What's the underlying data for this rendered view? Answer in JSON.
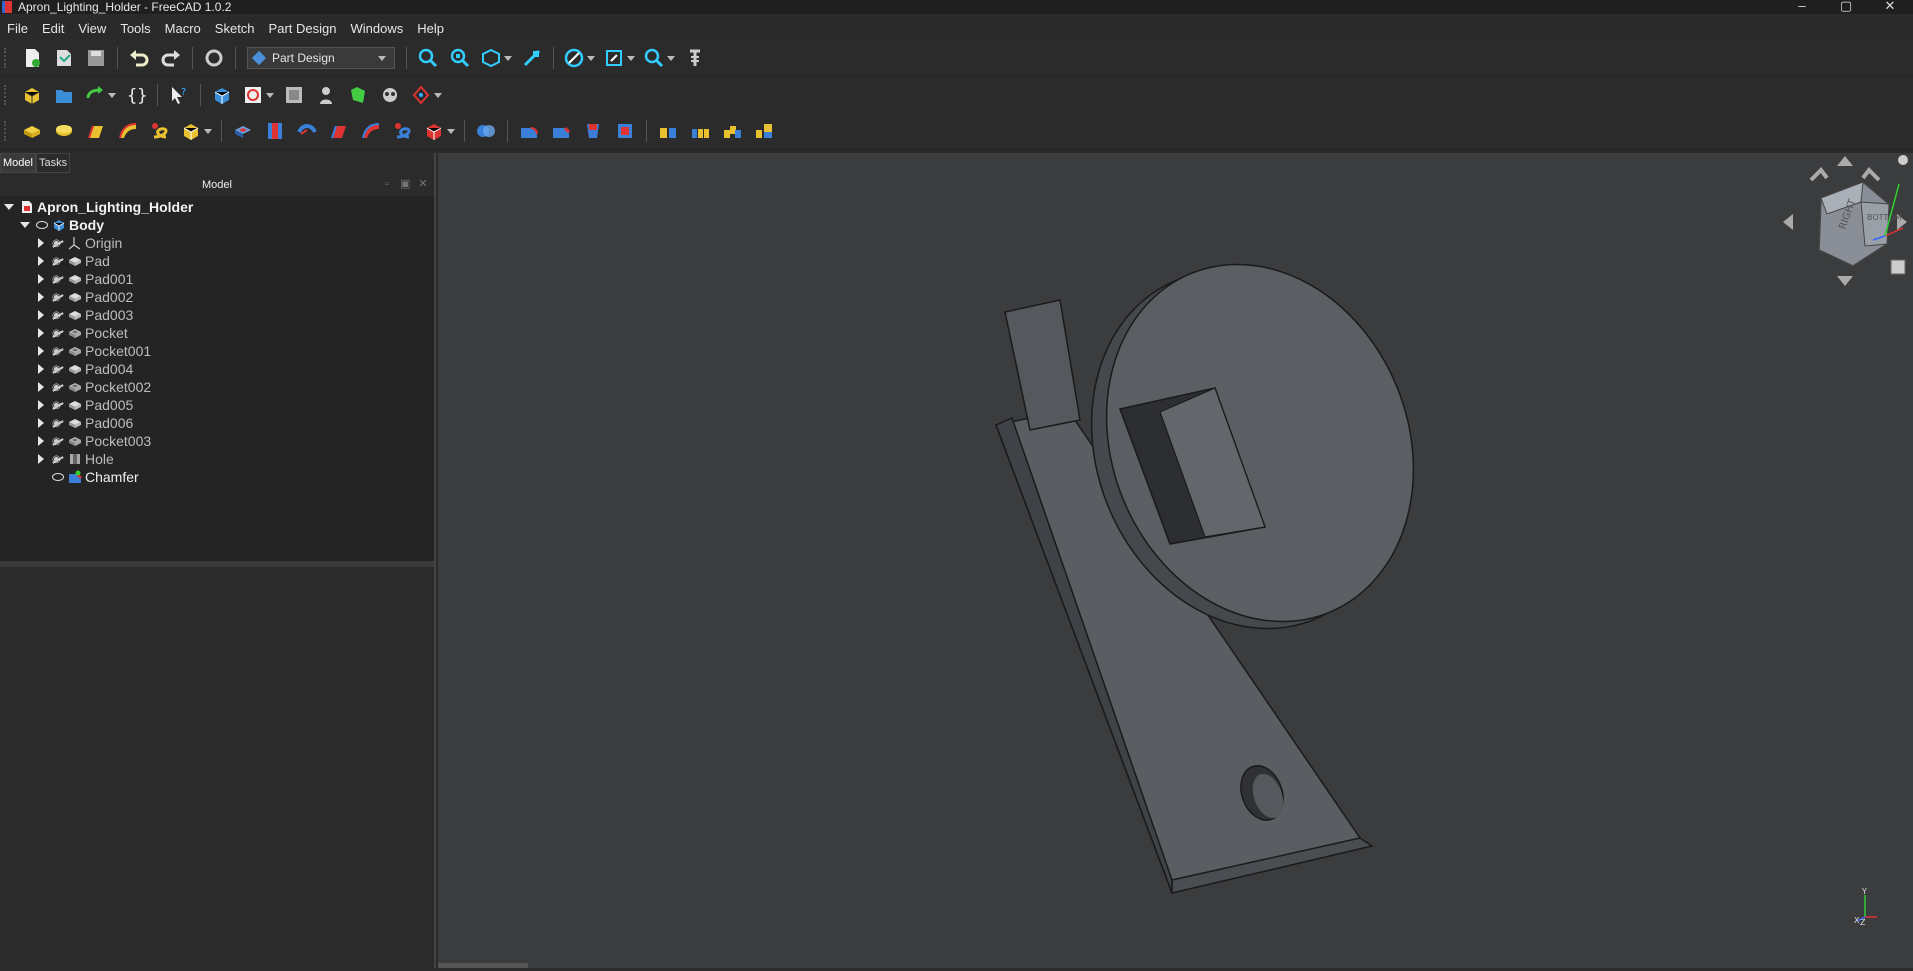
{
  "window": {
    "title": "Apron_Lighting_Holder - FreeCAD 1.0.2",
    "controls": [
      "–",
      "▢",
      "✕"
    ]
  },
  "menu": [
    "File",
    "Edit",
    "View",
    "Tools",
    "Macro",
    "Sketch",
    "Part Design",
    "Windows",
    "Help"
  ],
  "toolbar": {
    "workbench": "Part Design",
    "row1_icons": [
      "new-document-icon",
      "open-document-icon",
      "save-icon",
      "undo-icon",
      "redo-icon",
      "refresh-icon",
      "fit-all-icon",
      "fit-selection-icon",
      "isometric-view-icon",
      "measure-icon",
      "draw-style-icon",
      "std-views-icon",
      "zoom-icon",
      "measure-tool-icon"
    ],
    "row2_icons": [
      "create-part-icon",
      "create-group-icon",
      "link-icon",
      "braces-icon",
      "whats-this-icon",
      "create-body-icon",
      "create-sketch-icon",
      "attach-sketch-icon",
      "validate-sketch-icon",
      "clone-icon",
      "shape-binder-icon",
      "datum-icon"
    ],
    "row3_icons": [
      "pad-icon",
      "revolution-icon",
      "loft-icon",
      "pipe-icon",
      "helix-icon",
      "additive-primitive-icon",
      "pocket-icon",
      "hole-icon",
      "groove-icon",
      "subtractive-loft-icon",
      "subtractive-pipe-icon",
      "subtractive-helix-icon",
      "subtractive-primitive-icon",
      "boolean-icon",
      "fillet-icon",
      "chamfer-icon",
      "draft-icon",
      "thickness-icon",
      "mirrored-icon",
      "linear-pattern-icon",
      "polar-pattern-icon",
      "multi-transform-icon"
    ]
  },
  "panel": {
    "tabs": [
      "Model",
      "Tasks"
    ],
    "header": "Model",
    "tree": [
      {
        "label": "Apron_Lighting_Holder",
        "level": 0,
        "expanded": true,
        "icon": "document-icon",
        "bold": true
      },
      {
        "label": "Body",
        "level": 1,
        "expanded": true,
        "icon": "body-icon",
        "bold": true,
        "visible": true
      },
      {
        "label": "Origin",
        "level": 2,
        "icon": "origin-icon"
      },
      {
        "label": "Pad",
        "level": 2,
        "icon": "pad-icon"
      },
      {
        "label": "Pad001",
        "level": 2,
        "icon": "pad-icon"
      },
      {
        "label": "Pad002",
        "level": 2,
        "icon": "pad-icon"
      },
      {
        "label": "Pad003",
        "level": 2,
        "icon": "pad-icon"
      },
      {
        "label": "Pocket",
        "level": 2,
        "icon": "pocket-icon"
      },
      {
        "label": "Pocket001",
        "level": 2,
        "icon": "pocket-icon"
      },
      {
        "label": "Pad004",
        "level": 2,
        "icon": "pad-icon"
      },
      {
        "label": "Pocket002",
        "level": 2,
        "icon": "pocket-icon"
      },
      {
        "label": "Pad005",
        "level": 2,
        "icon": "pad-icon"
      },
      {
        "label": "Pad006",
        "level": 2,
        "icon": "pad-icon"
      },
      {
        "label": "Pocket003",
        "level": 2,
        "icon": "pocket-icon"
      },
      {
        "label": "Hole",
        "level": 2,
        "icon": "hole-icon"
      },
      {
        "label": "Chamfer",
        "level": 2,
        "icon": "chamfer-icon",
        "visible": true,
        "noarrow": true
      }
    ]
  },
  "viewport": {
    "navcube_faces": [
      "RIGHT",
      "BOTTOM"
    ],
    "axis_labels": [
      "Y",
      "X",
      "Z"
    ]
  }
}
